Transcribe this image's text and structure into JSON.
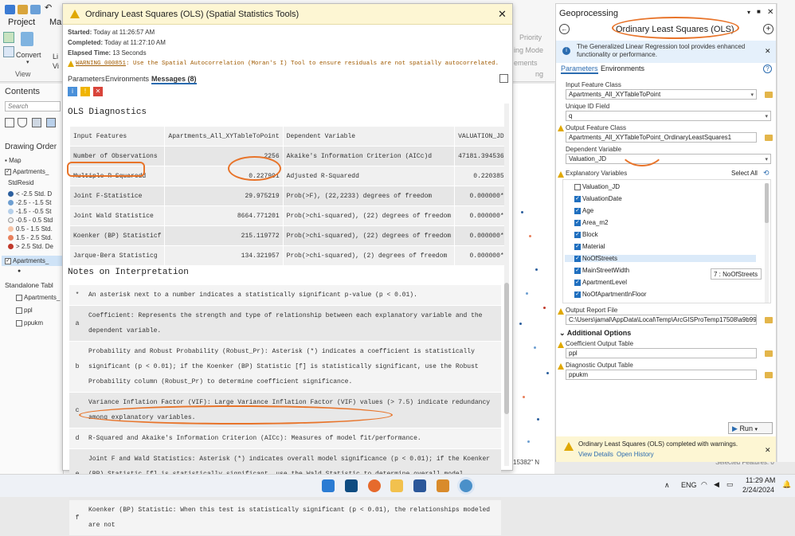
{
  "ribbon": {
    "tabs": [
      "Project",
      "Map"
    ],
    "convert": "Convert",
    "view": "View",
    "li": "Li",
    "vi": "Vi",
    "priority": "Priority",
    "mode": "ing Mode",
    "ements": "ements",
    "ng": "ng"
  },
  "contents": {
    "title": "Contents",
    "search": "Search",
    "drawing_order": "Drawing Order",
    "items": [
      "Map",
      "Apartments_",
      "StdResid",
      "< -2.5 Std. D",
      "-2.5 - -1.5 St",
      "-1.5 - -0.5 St",
      "-0.5 - 0.5 Std",
      "0.5 - 1.5 Std.",
      "1.5 - 2.5 Std.",
      "> 2.5 Std. De",
      "Apartments_"
    ],
    "standalone": "Standalone Tabl",
    "tables": [
      "Apartments_",
      "ppl",
      "ppukm"
    ],
    "swatches": [
      "#2c5f9e",
      "#6e9fd1",
      "#b6d0ea",
      "#f0f0f0",
      "#f7c3a4",
      "#e8805c",
      "#c0392b"
    ]
  },
  "dialog": {
    "title": "Ordinary Least Squares (OLS) (Spatial Statistics Tools)",
    "started_label": "Started:",
    "started": "Today at 11:26:57 AM",
    "completed_label": "Completed:",
    "completed": "Today at 11:27:10 AM",
    "elapsed_label": "Elapsed Time:",
    "elapsed": "13 Seconds",
    "warning_code": "WARNING 000851",
    "warning_text": ": Use the Spatial Autocorrelation (Moran's I) Tool to ensure residuals are not spatially autocorrelated.",
    "tabs": [
      "Parameters",
      "Environments",
      "Messages (8)"
    ],
    "diag_title": "OLS Diagnostics",
    "diag_rows": [
      [
        "Input Features",
        "Apartments_All_XYTableToPoint",
        "Dependent Variable",
        "VALUATION_JD"
      ],
      [
        "Number of Observations",
        "2256",
        "Akaike's Information Criterion (AICc)d",
        "47181.394536"
      ],
      [
        "Multiple R-Squaredd",
        "0.227991",
        "Adjusted R-Squaredd",
        "0.220385"
      ],
      [
        "Joint F-Statistice",
        "29.975219",
        "Prob(>F), (22,2233) degrees of freedom",
        "0.000000*"
      ],
      [
        "Joint Wald Statistice",
        "8664.771201",
        "Prob(>chi-squared), (22) degrees of freedom",
        "0.000000*"
      ],
      [
        "Koenker (BP) Statisticf",
        "215.119772",
        "Prob(>chi-squared), (22) degrees of freedom",
        "0.000000*"
      ],
      [
        "Jarque-Bera Statisticg",
        "134.321957",
        "Prob(>chi-squared), (2) degrees of freedom",
        "0.000000*"
      ]
    ],
    "notes_title": "Notes on Interpretation",
    "notes": [
      [
        "*",
        "An asterisk next to a number indicates a statistically significant p-value (p < 0.01)."
      ],
      [
        "a",
        "Coefficient: Represents the strength and type of relationship between each explanatory variable and the dependent variable."
      ],
      [
        "b",
        "Probability and Robust Probability (Robust_Pr): Asterisk (*) indicates a coefficient is statistically significant (p < 0.01); if the Koenker (BP) Statistic [f] is statistically significant, use the Robust Probability column (Robust_Pr) to determine coefficient significance."
      ],
      [
        "c",
        "Variance Inflation Factor (VIF): Large Variance Inflation Factor (VIF) values (> 7.5) indicate redundancy among explanatory variables."
      ],
      [
        "d",
        "R-Squared and Akaike's Information Criterion (AICc): Measures of model fit/performance."
      ],
      [
        "e",
        "Joint F and Wald Statistics: Asterisk (*) indicates overall model significance (p < 0.01); if the Koenker (BP) Statistic [f] is statistically significant, use the Wald Statistic to determine overall model significance."
      ],
      [
        "f",
        "Koenker (BP) Statistic: When this test is statistically significant (p < 0.01), the relationships modeled are not"
      ]
    ]
  },
  "gp": {
    "header": "Geoprocessing",
    "tool": "Ordinary Least Squares (OLS)",
    "info": "The Generalized Linear Regression tool provides enhanced functionality or performance.",
    "info_link": "Generalized Linear Regression",
    "tabs": [
      "Parameters",
      "Environments"
    ],
    "input_label": "Input Feature Class",
    "input": "Apartments_All_XYTableToPoint",
    "uid_label": "Unique ID Field",
    "uid": "q",
    "out_label": "Output Feature Class",
    "out": "Apartments_All_XYTableToPoint_OrdinaryLeastSquares1",
    "dep_label": "Dependent Variable",
    "dep": "Valuation_JD",
    "expl_label": "Explanatory Variables",
    "select_all": "Select All",
    "vars": [
      {
        "n": "Valuation_JD",
        "c": false
      },
      {
        "n": "ValuationDate",
        "c": true
      },
      {
        "n": "Age",
        "c": true
      },
      {
        "n": "Area_m2",
        "c": true
      },
      {
        "n": "Block",
        "c": true
      },
      {
        "n": "Material",
        "c": true
      },
      {
        "n": "NoOfStreets",
        "c": true
      },
      {
        "n": "MainStreetWidth",
        "c": true
      },
      {
        "n": "ApartmentLevel",
        "c": true
      },
      {
        "n": "NoOfApartmentInFloor",
        "c": true
      }
    ],
    "tooltip": "7 : NoOfStreets",
    "report_label": "Output Report File",
    "report": "C:\\Users\\jamal\\AppData\\Local\\Temp\\ArcGISProTemp17508\\a9b9903",
    "additional": "Additional Options",
    "coef_label": "Coefficient Output Table",
    "coef": "ppl",
    "diagout_label": "Diagnostic Output Table",
    "diagout": "ppukm",
    "run": "Run",
    "status": "Ordinary Least Squares (OLS) completed with warnings.",
    "view_details": "View Details",
    "open_history": "Open History",
    "map_status": "15382\" N",
    "selected": "Selected Features: 0"
  },
  "taskbar": {
    "lang": "ENG",
    "time": "11:29 AM",
    "date": "2/24/2024"
  },
  "colors": {
    "accent": "#e8742a",
    "warn": "#e0a800",
    "link": "#1f6fbf"
  }
}
